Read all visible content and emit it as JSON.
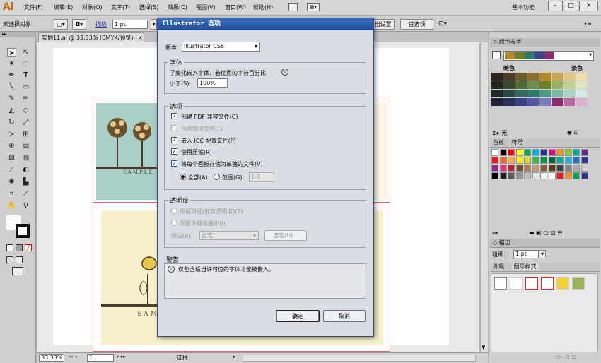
{
  "app": {
    "logo": "Ai",
    "menus": [
      "文件(F)",
      "编辑(E)",
      "对象(O)",
      "文字(T)",
      "选择(S)",
      "效果(C)",
      "视图(V)",
      "窗口(W)",
      "帮助(H)"
    ],
    "workspace": "基本功能",
    "accent": "#214c9a"
  },
  "control_bar": {
    "selection_label": "未选择对象",
    "stroke_label": "描边",
    "stroke_value": "1 pt",
    "doc_setup_label": "档设置",
    "preferences_label": "首选项"
  },
  "document": {
    "tab_title": "实例11.ai @ 33.33% (CMYK/预览)",
    "card_text_1": "SAMPLE T",
    "card_text_2": "SAM"
  },
  "status_bar": {
    "zoom": "33.33%",
    "page": "1",
    "status_text": "选择"
  },
  "swatches_panel": {
    "title": "颜色参考",
    "label_dark": "暗色",
    "label_light": "淡色",
    "footer_none": "无",
    "tab_swatches": "色板",
    "tab_symbols": "符号"
  },
  "stroke_panel": {
    "title": "描边",
    "weight_label": "粗细:",
    "weight_value": "1 pt"
  },
  "appearance_panel": {
    "tab_appearance": "外观",
    "tab_graphic_styles": "图形样式"
  },
  "dialog": {
    "title": "Illustrator 选项",
    "version_label": "版本:",
    "version_value": "Illustrator CS6",
    "fonts_group": "字体",
    "fonts_desc": "子集化嵌入字体，若使用的字符百分比",
    "fonts_less_than": "小于(S):",
    "fonts_percent": "100%",
    "options_group": "选项",
    "opt_pdf": "创建 PDF 兼容文件(C)",
    "opt_linked": "包含链接文件(L)",
    "opt_icc": "嵌入 ICC 配置文件(P)",
    "opt_compress": "使用压缩(R)",
    "opt_artboards": "将每个画板存储为单独的文件(V)",
    "radio_all": "全部(A)",
    "radio_range": "范围(G):",
    "range_value": "1-3",
    "transparency_group": "透明度",
    "trans_keep_paths": "保留路径(放弃透明度)(T)",
    "trans_keep_appearance": "保留外观和叠印(I)",
    "preset_label": "预设(R):",
    "preset_value": "自定",
    "custom_button": "自定(U)...",
    "warning_group": "警告",
    "warning_text": "仅包含适当许可位的字体才能被嵌入。",
    "ok_button": "确定",
    "cancel_button": "取消"
  }
}
